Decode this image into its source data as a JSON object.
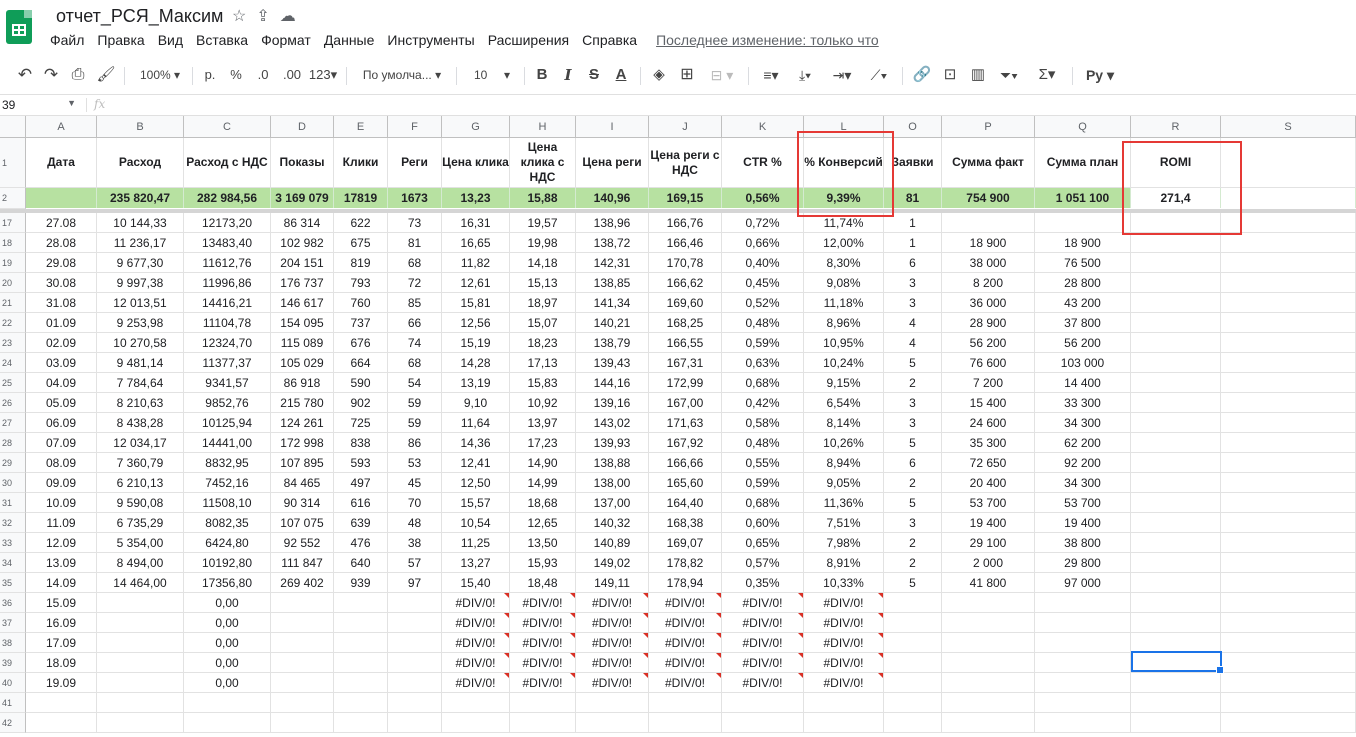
{
  "doc": {
    "title": "отчет_РСЯ_Максим"
  },
  "menu": [
    "Файл",
    "Правка",
    "Вид",
    "Вставка",
    "Формат",
    "Данные",
    "Инструменты",
    "Расширения",
    "Справка"
  ],
  "last_edit": "Последнее изменение: только что",
  "toolbar": {
    "zoom": "100%",
    "currency": "р.",
    "percent": "%",
    "dec_less": ".0",
    "dec_more": ".00",
    "num_format": "123",
    "font": "По умолча...",
    "font_size": "10",
    "bold": "B",
    "italic": "I",
    "strike": "S",
    "text_color": "A",
    "input_tools": "Ру"
  },
  "formula_bar": {
    "name_box": "39",
    "fx": "fx"
  },
  "columns": [
    "A",
    "B",
    "C",
    "D",
    "E",
    "F",
    "G",
    "H",
    "I",
    "J",
    "K",
    "L",
    "O",
    "P",
    "Q",
    "R",
    "S"
  ],
  "headers": [
    "Дата",
    "Расход",
    "Расход с НДС",
    "Показы",
    "Клики",
    "Реги",
    "Цена клика",
    "Цена клика с НДС",
    "Цена реги",
    "Цена реги с НДС",
    "CTR %",
    "% Конверсий",
    "Заявки",
    "Сумма факт",
    "Сумма план",
    "ROMI",
    ""
  ],
  "summary": [
    "",
    "235 820,47",
    "282 984,56",
    "3 169 079",
    "17819",
    "1673",
    "13,23",
    "15,88",
    "140,96",
    "169,15",
    "0,56%",
    "9,39%",
    "81",
    "754 900",
    "1 051 100",
    "271,4",
    ""
  ],
  "row_numbers": [
    "1",
    "2",
    "17",
    "18",
    "19",
    "20",
    "21",
    "22",
    "23",
    "24",
    "25",
    "26",
    "27",
    "28",
    "29",
    "30",
    "31",
    "32",
    "33",
    "34",
    "35",
    "36",
    "37",
    "38",
    "39",
    "40",
    "41",
    "42"
  ],
  "rows": [
    [
      "27.08",
      "10 144,33",
      "12173,20",
      "86 314",
      "622",
      "73",
      "16,31",
      "19,57",
      "138,96",
      "166,76",
      "0,72%",
      "11,74%",
      "1",
      "",
      "",
      "",
      ""
    ],
    [
      "28.08",
      "11 236,17",
      "13483,40",
      "102 982",
      "675",
      "81",
      "16,65",
      "19,98",
      "138,72",
      "166,46",
      "0,66%",
      "12,00%",
      "1",
      "18 900",
      "18 900",
      "",
      ""
    ],
    [
      "29.08",
      "9 677,30",
      "11612,76",
      "204 151",
      "819",
      "68",
      "11,82",
      "14,18",
      "142,31",
      "170,78",
      "0,40%",
      "8,30%",
      "6",
      "38 000",
      "76 500",
      "",
      ""
    ],
    [
      "30.08",
      "9 997,38",
      "11996,86",
      "176 737",
      "793",
      "72",
      "12,61",
      "15,13",
      "138,85",
      "166,62",
      "0,45%",
      "9,08%",
      "3",
      "8 200",
      "28 800",
      "",
      ""
    ],
    [
      "31.08",
      "12 013,51",
      "14416,21",
      "146 617",
      "760",
      "85",
      "15,81",
      "18,97",
      "141,34",
      "169,60",
      "0,52%",
      "11,18%",
      "3",
      "36 000",
      "43 200",
      "",
      ""
    ],
    [
      "01.09",
      "9 253,98",
      "11104,78",
      "154 095",
      "737",
      "66",
      "12,56",
      "15,07",
      "140,21",
      "168,25",
      "0,48%",
      "8,96%",
      "4",
      "28 900",
      "37 800",
      "",
      ""
    ],
    [
      "02.09",
      "10 270,58",
      "12324,70",
      "115 089",
      "676",
      "74",
      "15,19",
      "18,23",
      "138,79",
      "166,55",
      "0,59%",
      "10,95%",
      "4",
      "56 200",
      "56 200",
      "",
      ""
    ],
    [
      "03.09",
      "9 481,14",
      "11377,37",
      "105 029",
      "664",
      "68",
      "14,28",
      "17,13",
      "139,43",
      "167,31",
      "0,63%",
      "10,24%",
      "5",
      "76 600",
      "103 000",
      "",
      ""
    ],
    [
      "04.09",
      "7 784,64",
      "9341,57",
      "86 918",
      "590",
      "54",
      "13,19",
      "15,83",
      "144,16",
      "172,99",
      "0,68%",
      "9,15%",
      "2",
      "7 200",
      "14 400",
      "",
      ""
    ],
    [
      "05.09",
      "8 210,63",
      "9852,76",
      "215 780",
      "902",
      "59",
      "9,10",
      "10,92",
      "139,16",
      "167,00",
      "0,42%",
      "6,54%",
      "3",
      "15 400",
      "33 300",
      "",
      ""
    ],
    [
      "06.09",
      "8 438,28",
      "10125,94",
      "124 261",
      "725",
      "59",
      "11,64",
      "13,97",
      "143,02",
      "171,63",
      "0,58%",
      "8,14%",
      "3",
      "24 600",
      "34 300",
      "",
      ""
    ],
    [
      "07.09",
      "12 034,17",
      "14441,00",
      "172 998",
      "838",
      "86",
      "14,36",
      "17,23",
      "139,93",
      "167,92",
      "0,48%",
      "10,26%",
      "5",
      "35 300",
      "62 200",
      "",
      ""
    ],
    [
      "08.09",
      "7 360,79",
      "8832,95",
      "107 895",
      "593",
      "53",
      "12,41",
      "14,90",
      "138,88",
      "166,66",
      "0,55%",
      "8,94%",
      "6",
      "72 650",
      "92 200",
      "",
      ""
    ],
    [
      "09.09",
      "6 210,13",
      "7452,16",
      "84 465",
      "497",
      "45",
      "12,50",
      "14,99",
      "138,00",
      "165,60",
      "0,59%",
      "9,05%",
      "2",
      "20 400",
      "34 300",
      "",
      ""
    ],
    [
      "10.09",
      "9 590,08",
      "11508,10",
      "90 314",
      "616",
      "70",
      "15,57",
      "18,68",
      "137,00",
      "164,40",
      "0,68%",
      "11,36%",
      "5",
      "53 700",
      "53 700",
      "",
      ""
    ],
    [
      "11.09",
      "6 735,29",
      "8082,35",
      "107 075",
      "639",
      "48",
      "10,54",
      "12,65",
      "140,32",
      "168,38",
      "0,60%",
      "7,51%",
      "3",
      "19 400",
      "19 400",
      "",
      ""
    ],
    [
      "12.09",
      "5 354,00",
      "6424,80",
      "92 552",
      "476",
      "38",
      "11,25",
      "13,50",
      "140,89",
      "169,07",
      "0,65%",
      "7,98%",
      "2",
      "29 100",
      "38 800",
      "",
      ""
    ],
    [
      "13.09",
      "8 494,00",
      "10192,80",
      "111 847",
      "640",
      "57",
      "13,27",
      "15,93",
      "149,02",
      "178,82",
      "0,57%",
      "8,91%",
      "2",
      "2 000",
      "29 800",
      "",
      ""
    ],
    [
      "14.09",
      "14 464,00",
      "17356,80",
      "269 402",
      "939",
      "97",
      "15,40",
      "18,48",
      "149,11",
      "178,94",
      "0,35%",
      "10,33%",
      "5",
      "41 800",
      "97 000",
      "",
      ""
    ],
    [
      "15.09",
      "",
      "0,00",
      "",
      "",
      "",
      "#DIV/0!",
      "#DIV/0!",
      "#DIV/0!",
      "#DIV/0!",
      "#DIV/0!",
      "#DIV/0!",
      "",
      "",
      "",
      "",
      ""
    ],
    [
      "16.09",
      "",
      "0,00",
      "",
      "",
      "",
      "#DIV/0!",
      "#DIV/0!",
      "#DIV/0!",
      "#DIV/0!",
      "#DIV/0!",
      "#DIV/0!",
      "",
      "",
      "",
      "",
      ""
    ],
    [
      "17.09",
      "",
      "0,00",
      "",
      "",
      "",
      "#DIV/0!",
      "#DIV/0!",
      "#DIV/0!",
      "#DIV/0!",
      "#DIV/0!",
      "#DIV/0!",
      "",
      "",
      "",
      "",
      ""
    ],
    [
      "18.09",
      "",
      "0,00",
      "",
      "",
      "",
      "#DIV/0!",
      "#DIV/0!",
      "#DIV/0!",
      "#DIV/0!",
      "#DIV/0!",
      "#DIV/0!",
      "",
      "",
      "",
      "",
      ""
    ],
    [
      "19.09",
      "",
      "0,00",
      "",
      "",
      "",
      "#DIV/0!",
      "#DIV/0!",
      "#DIV/0!",
      "#DIV/0!",
      "#DIV/0!",
      "#DIV/0!",
      "",
      "",
      "",
      "",
      ""
    ],
    [
      "",
      "",
      "",
      "",
      "",
      "",
      "",
      "",
      "",
      "",
      "",
      "",
      "",
      "",
      "",
      "",
      ""
    ],
    [
      "",
      "",
      "",
      "",
      "",
      "",
      "",
      "",
      "",
      "",
      "",
      "",
      "",
      "",
      "",
      "",
      ""
    ]
  ],
  "colors": {
    "summary_row": "#b7e1a1",
    "highlight_box": "#e53935",
    "selection": "#1a73e8",
    "logo": "#0f9d58"
  }
}
